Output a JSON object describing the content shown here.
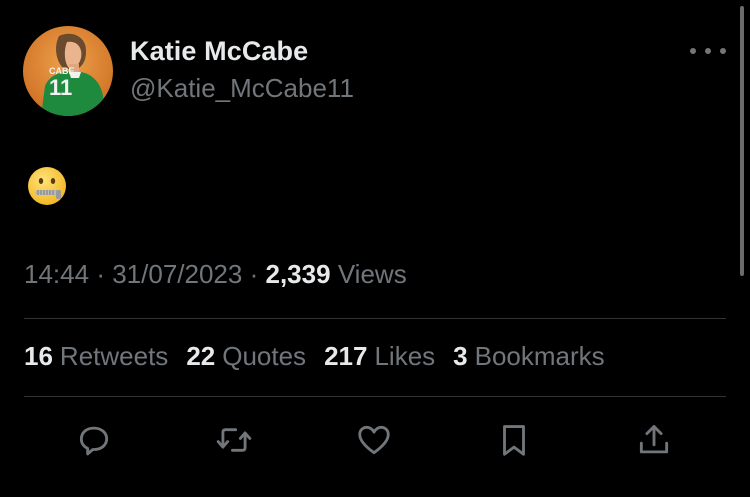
{
  "tweet": {
    "display_name": "Katie McCabe",
    "handle": "@Katie_McCabe11",
    "avatar_jersey_text": "CABE",
    "avatar_jersey_number": "11",
    "content_emoji": "zipper-mouth-face",
    "time": "14:44",
    "separator": "·",
    "date": "31/07/2023",
    "views_count": "2,339",
    "views_label": "Views"
  },
  "stats": [
    {
      "count": "16",
      "label": "Retweets"
    },
    {
      "count": "22",
      "label": "Quotes"
    },
    {
      "count": "217",
      "label": "Likes"
    },
    {
      "count": "3",
      "label": "Bookmarks"
    }
  ],
  "actions": [
    "reply-icon",
    "retweet-icon",
    "like-icon",
    "bookmark-icon",
    "share-icon"
  ],
  "colors": {
    "background": "#000000",
    "primary_text": "#e7e9ea",
    "secondary_text": "#71767b",
    "divider": "#2f3336",
    "avatar_bg": "#d9832f",
    "jersey": "#1e8a3e"
  }
}
